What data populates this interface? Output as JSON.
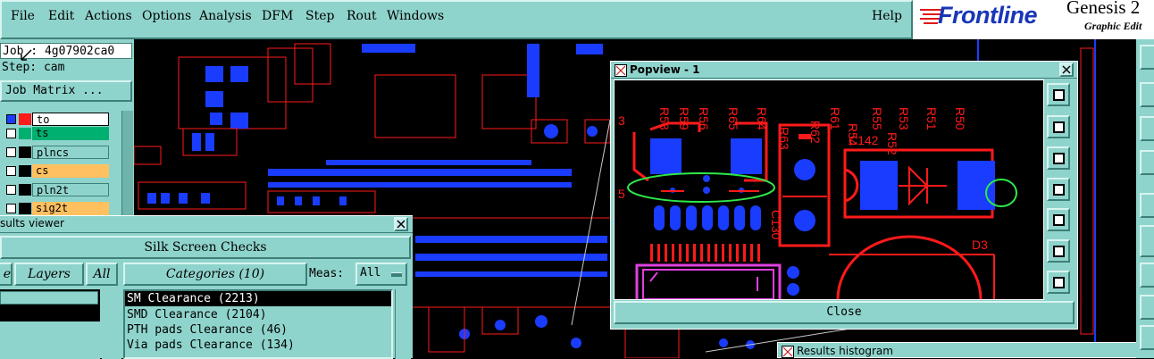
{
  "menubar": {
    "items": [
      "File",
      "Edit",
      "Actions",
      "Options",
      "Analysis",
      "DFM",
      "Step",
      "Rout",
      "Windows"
    ],
    "help": "Help"
  },
  "brand": {
    "logo": "Frontline",
    "product": "Genesis 2",
    "subtitle": "Graphic Edit"
  },
  "job_panel": {
    "job": "Job : 4g07902ca0",
    "step": "Step: cam",
    "job_matrix": "Job Matrix ..."
  },
  "layers": [
    {
      "name": "to",
      "color": "#ff1a1a",
      "bg": "#ffffff"
    },
    {
      "name": "ts",
      "color": "#00b070",
      "bg": "#00b070"
    },
    {
      "name": "plncs",
      "color": "#000000",
      "bg": "#8fd4cc"
    },
    {
      "name": "cs",
      "color": "#000000",
      "bg": "#ffc060"
    },
    {
      "name": "pln2t",
      "color": "#000000",
      "bg": "#8fd4cc"
    },
    {
      "name": "sig2t",
      "color": "#000000",
      "bg": "#ffc060"
    }
  ],
  "results_viewer": {
    "title": "sults viewer",
    "heading": "Silk Screen Checks",
    "tab_left": "e",
    "layers_label": "Layers",
    "all_btn": "All",
    "categories_label": "Categories (10)",
    "meas_label": "Meas:",
    "meas_value": "All",
    "categories": [
      "SM Clearance (2213)",
      "SMD Clearance (2104)",
      "PTH pads Clearance (46)",
      "Via pads Clearance (134)"
    ]
  },
  "popview": {
    "title": "Popview - 1",
    "close_label": "Close",
    "refdes_top": [
      "R58",
      "R59",
      "R56",
      "R65",
      "R64",
      "R63",
      "R61",
      "R62",
      "R54",
      "R55",
      "R53",
      "R52",
      "R51",
      "R50"
    ],
    "labels": {
      "c142": "C142",
      "c130": "C130",
      "d3": "D3",
      "n3": "3",
      "n5": "5"
    }
  },
  "histogram": {
    "title": "Results histogram"
  },
  "colors": {
    "ui_teal": "#8fd4cc",
    "copper_red": "#ff1a1a",
    "pad_blue": "#1a3cff",
    "highlight_green": "#2ee84a",
    "silk_magenta": "#e040e0"
  }
}
